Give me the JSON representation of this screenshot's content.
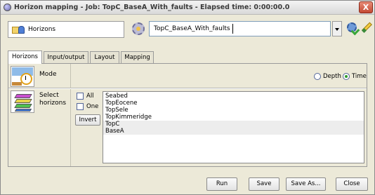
{
  "window": {
    "title": "Horizon mapping - Job: TopC_BaseA_With_faults - Elapsed time: 0:00:00.0",
    "close_glyph": "X"
  },
  "toolbar": {
    "project_label": "Horizons",
    "job_value": "TopC_BaseA_With_faults"
  },
  "tabs": [
    {
      "label": "Horizons",
      "active": true
    },
    {
      "label": "Input/output",
      "active": false
    },
    {
      "label": "Layout",
      "active": false
    },
    {
      "label": "Mapping",
      "active": false
    }
  ],
  "mode": {
    "label": "Mode",
    "options": [
      {
        "label": "Depth",
        "selected": false
      },
      {
        "label": "Time",
        "selected": true
      }
    ]
  },
  "select_horizons": {
    "label": "Select horizons",
    "all_label": "All",
    "one_label": "One",
    "invert_label": "Invert",
    "items": [
      "Seabed",
      "TopEocene",
      "TopSele",
      "TopKimmeridge",
      "TopC",
      "BaseA"
    ]
  },
  "buttons": {
    "run": "Run",
    "save": "Save",
    "save_as": "Save As...",
    "close": "Close"
  },
  "icons": {
    "app": "app-sphere-icon",
    "project": "horizons-folder-icon",
    "job_settings": "gear-icon",
    "run_settings": "gear-check-icon",
    "edit": "pencil-icon",
    "mode": "clock-landscape-icon",
    "select": "layers-icon"
  },
  "colors": {
    "window_bg": "#ece9d8",
    "close_button": "#c34a33",
    "selected_radio": "#2b9a2b"
  }
}
